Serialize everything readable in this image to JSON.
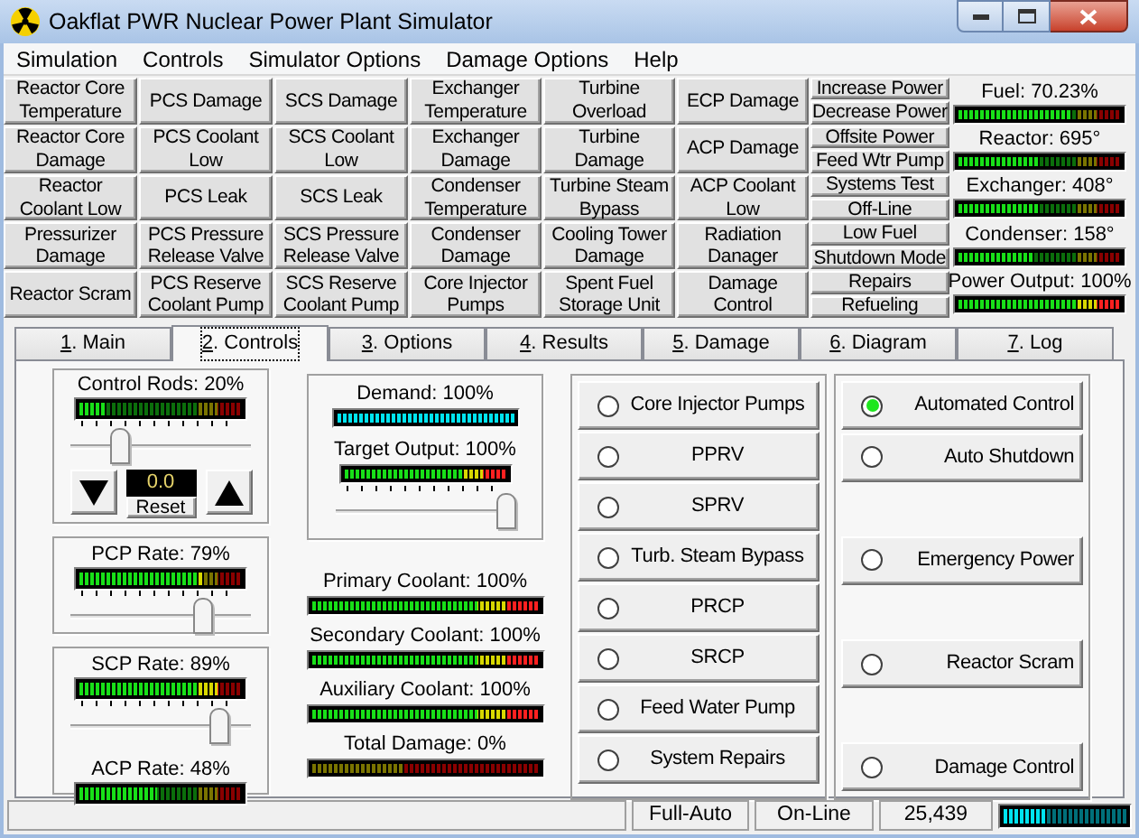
{
  "window": {
    "title": "Oakflat PWR Nuclear Power Plant Simulator"
  },
  "menu": [
    "Simulation",
    "Controls",
    "Simulator Options",
    "Damage Options",
    "Help"
  ],
  "alarm_grid": [
    [
      "Reactor Core Temperature",
      "PCS Damage",
      "SCS Damage",
      "Exchanger Temperature",
      "Turbine Overload",
      "ECP Damage"
    ],
    [
      "Reactor Core Damage",
      "PCS Coolant Low",
      "SCS Coolant Low",
      "Exchanger Damage",
      "Turbine Damage",
      "ACP Damage"
    ],
    [
      "Reactor Coolant Low",
      "PCS Leak",
      "SCS Leak",
      "Condenser Temperature",
      "Turbine Steam Bypass",
      "ACP Coolant Low"
    ],
    [
      "Pressurizer Damage",
      "PCS Pressure Release Valve",
      "SCS Pressure Release Valve",
      "Condenser Damage",
      "Cooling Tower Damage",
      "Radiation Danager"
    ],
    [
      "Reactor Scram",
      "PCS Reserve Coolant Pump",
      "SCS Reserve Coolant Pump",
      "Core Injector Pumps",
      "Spent Fuel Storage Unit",
      "Damage Control"
    ]
  ],
  "status_buttons": [
    "Increase Power",
    "Decrease Power",
    "Offsite Power",
    "Feed Wtr Pump",
    "Systems Test",
    "Off-Line",
    "Low Fuel",
    "Shutdown Mode",
    "Repairs",
    "Refueling"
  ],
  "gauges": [
    {
      "label": "Fuel: 70.23%",
      "level": 0.7
    },
    {
      "label": "Reactor: 695°",
      "level": 0.5
    },
    {
      "label": "Exchanger: 408°",
      "level": 0.5
    },
    {
      "label": "Condenser: 158°",
      "level": 0.45
    },
    {
      "label": "Power Output: 100%",
      "level": 1
    }
  ],
  "tabs": [
    {
      "label": "1. Main",
      "selected": false
    },
    {
      "label": "2. Controls",
      "selected": true
    },
    {
      "label": "3. Options",
      "selected": false
    },
    {
      "label": "4. Results",
      "selected": false
    },
    {
      "label": "5. Damage",
      "selected": false
    },
    {
      "label": "6. Diagram",
      "selected": false
    },
    {
      "label": "7. Log",
      "selected": false
    }
  ],
  "control_rods": {
    "label": "Control Rods: 20%",
    "level": 0.15,
    "slider": {
      "level": 0.25
    },
    "display": "0.0",
    "reset": "Reset"
  },
  "pcp": {
    "label": "PCP Rate: 79%",
    "level": 0.76,
    "slider": {
      "level": 0.76
    }
  },
  "scp": {
    "label": "SCP Rate: 89%",
    "level": 0.86,
    "slider": {
      "level": 0.86
    }
  },
  "acp": {
    "label": "ACP Rate: 48%",
    "level": 0.48
  },
  "demand": {
    "label": "Demand: 100%",
    "level": 1
  },
  "target": {
    "label": "Target Output: 100%",
    "level": 1,
    "slider": {
      "level": 1
    }
  },
  "coolants": [
    {
      "label": "Primary Coolant: 100%",
      "kind": "standard",
      "level": 1
    },
    {
      "label": "Secondary Coolant: 100%",
      "kind": "standard",
      "level": 1
    },
    {
      "label": "Auxiliary Coolant: 100%",
      "kind": "standard",
      "level": 1
    },
    {
      "label": "Total Damage: 0%",
      "kind": "damage",
      "level": 0
    }
  ],
  "systems": [
    {
      "label": "Core Injector Pumps",
      "selected": false
    },
    {
      "label": "PPRV",
      "selected": false
    },
    {
      "label": "SPRV",
      "selected": false
    },
    {
      "label": "Turb. Steam Bypass",
      "selected": false
    },
    {
      "label": "PRCP",
      "selected": false
    },
    {
      "label": "SRCP",
      "selected": false
    },
    {
      "label": "Feed Water Pump",
      "selected": false
    },
    {
      "label": "System Repairs",
      "selected": false
    }
  ],
  "modes": [
    {
      "label": "Automated Control",
      "selected": true
    },
    {
      "label": "Auto Shutdown",
      "selected": false
    },
    {
      "label": "Emergency Power",
      "selected": false
    },
    {
      "label": "Reactor Scram",
      "selected": false
    },
    {
      "label": "Damage Control",
      "selected": false
    }
  ],
  "status_bar": {
    "cells": [
      "Full-Auto",
      "On-Line",
      "25,439"
    ],
    "meter": {
      "level": 0.35
    }
  }
}
